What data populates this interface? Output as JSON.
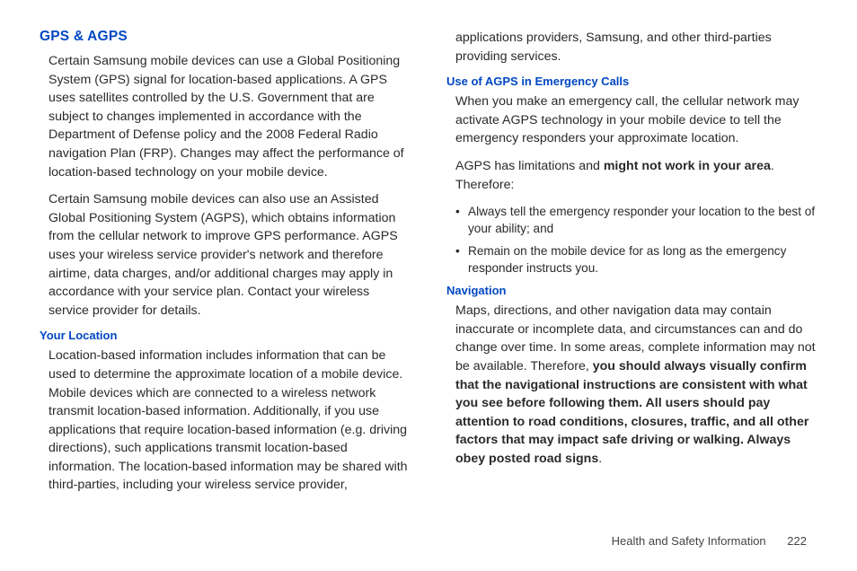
{
  "left": {
    "heading": "GPS & AGPS",
    "p1": "Certain Samsung mobile devices can use a Global Positioning System (GPS) signal for location-based applications. A GPS uses satellites controlled by the U.S. Government that are subject to changes implemented in accordance with the Department of Defense policy and the 2008 Federal Radio navigation Plan (FRP). Changes may affect the performance of location-based technology on your mobile device.",
    "p2": "Certain Samsung mobile devices can also use an Assisted Global Positioning System (AGPS), which obtains information from the cellular network to improve GPS performance. AGPS uses your wireless service provider's network and therefore airtime, data charges, and/or additional charges may apply in accordance with your service plan. Contact your wireless service provider for details.",
    "sub1": "Your Location",
    "p3": "Location-based information includes information that can be used to determine the approximate location of a mobile device. Mobile devices which are connected to a wireless network transmit location-based information. Additionally, if you use applications that require location-based information (e.g. driving directions), such applications transmit location-based information. The location-based information may be shared with third-parties, including your wireless service provider,"
  },
  "right": {
    "p0": "applications providers, Samsung, and other third-parties providing services.",
    "sub1": "Use of AGPS in Emergency Calls",
    "p1": "When you make an emergency call, the cellular network may activate AGPS technology in your mobile device to tell the emergency responders your approximate location.",
    "p2a": "AGPS has limitations and ",
    "p2b": "might not work in your area",
    "p2c": ". Therefore:",
    "li1": "Always tell the emergency responder your location to the best of your ability; and",
    "li2": "Remain on the mobile device for as long as the emergency responder instructs you.",
    "sub2": "Navigation",
    "p3a": "Maps, directions, and other navigation data may contain inaccurate or incomplete data, and circumstances can and do change over time. In some areas, complete information may not be available. Therefore, ",
    "p3b": "you should always visually confirm that the navigational instructions are consistent with what you see before following them. All users should pay attention to road conditions, closures, traffic, and all other factors that may impact safe driving or walking. Always obey posted road signs",
    "p3c": "."
  },
  "footer": {
    "section": "Health and Safety Information",
    "page": "222"
  }
}
